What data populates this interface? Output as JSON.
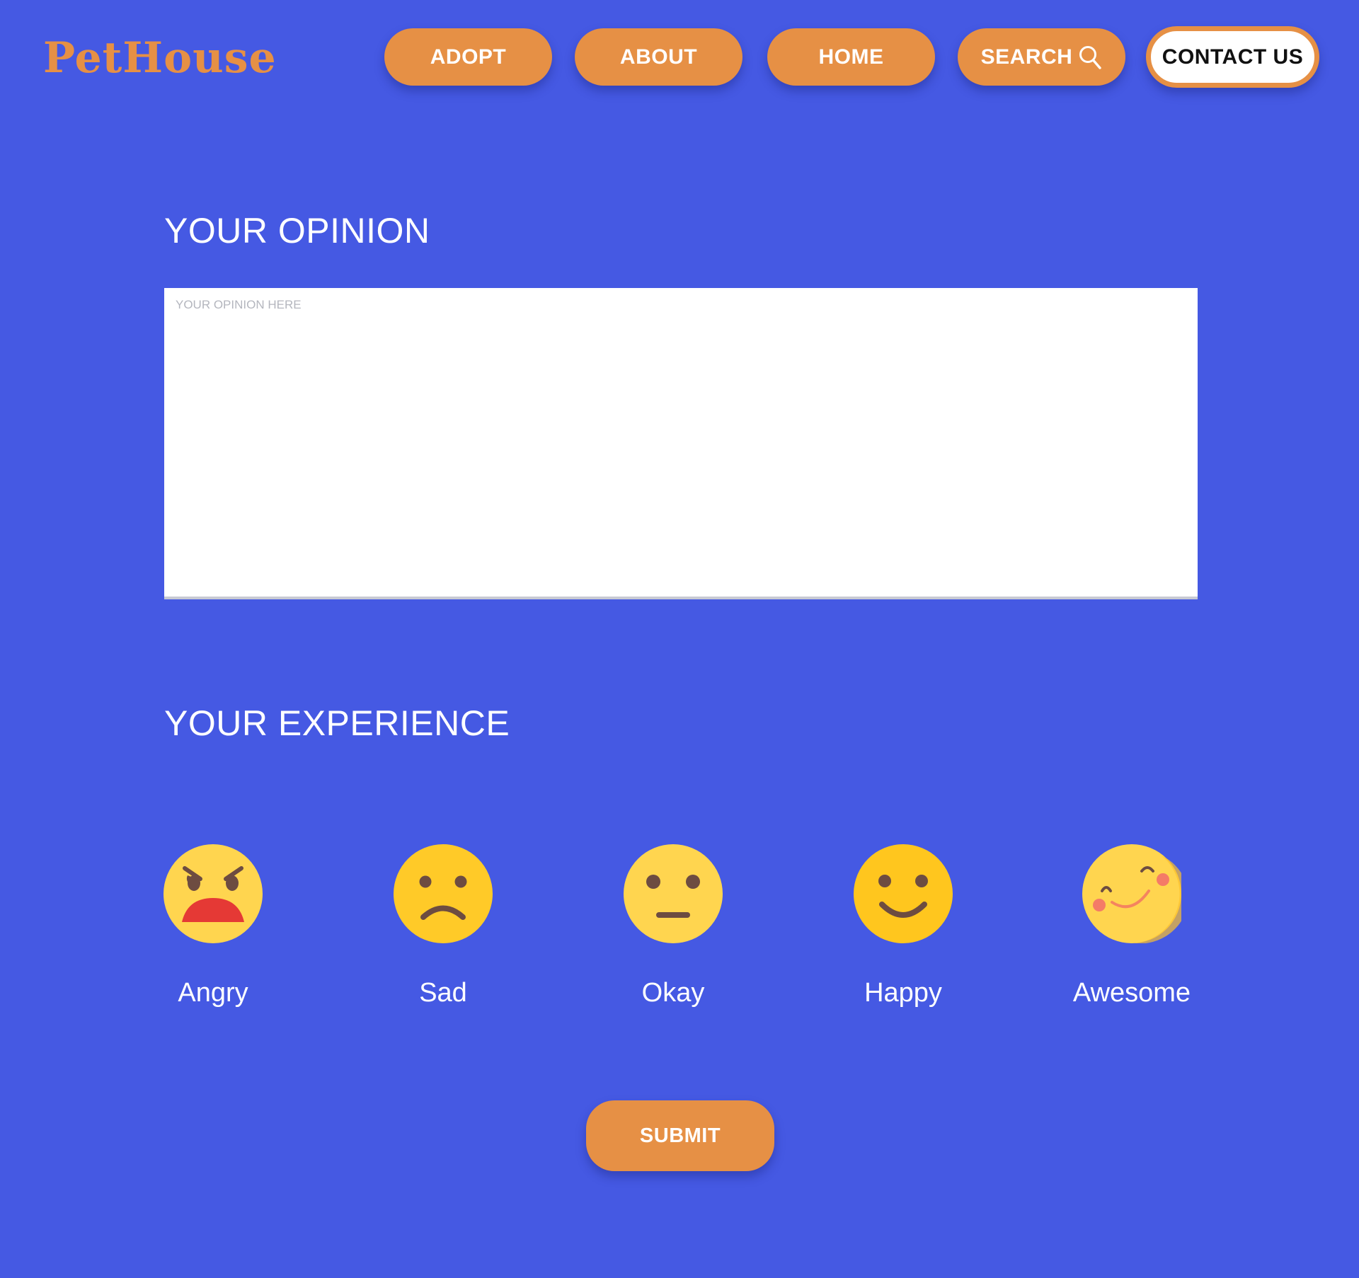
{
  "header": {
    "logo_text": "PetHouse",
    "nav": {
      "adopt": "ADOPT",
      "about": "ABOUT",
      "home": "HOME",
      "search": "SEARCH",
      "contact": "CONTACT US"
    },
    "icons": {
      "search": "search-icon"
    }
  },
  "opinion": {
    "title": "YOUR OPINION",
    "placeholder": "YOUR OPINION HERE",
    "value": ""
  },
  "experience": {
    "title": "YOUR EXPERIENCE",
    "options": [
      {
        "label": "Angry",
        "icon": "angry-face-icon"
      },
      {
        "label": "Sad",
        "icon": "sad-face-icon"
      },
      {
        "label": "Okay",
        "icon": "neutral-face-icon"
      },
      {
        "label": "Happy",
        "icon": "happy-face-icon"
      },
      {
        "label": "Awesome",
        "icon": "awesome-face-icon"
      }
    ]
  },
  "submit": {
    "label": "SUBMIT"
  },
  "colors": {
    "background": "#4559E3",
    "accent": "#E69045",
    "emoji_yellow": "#FFCB2B",
    "text_light": "#FFFFFF"
  }
}
